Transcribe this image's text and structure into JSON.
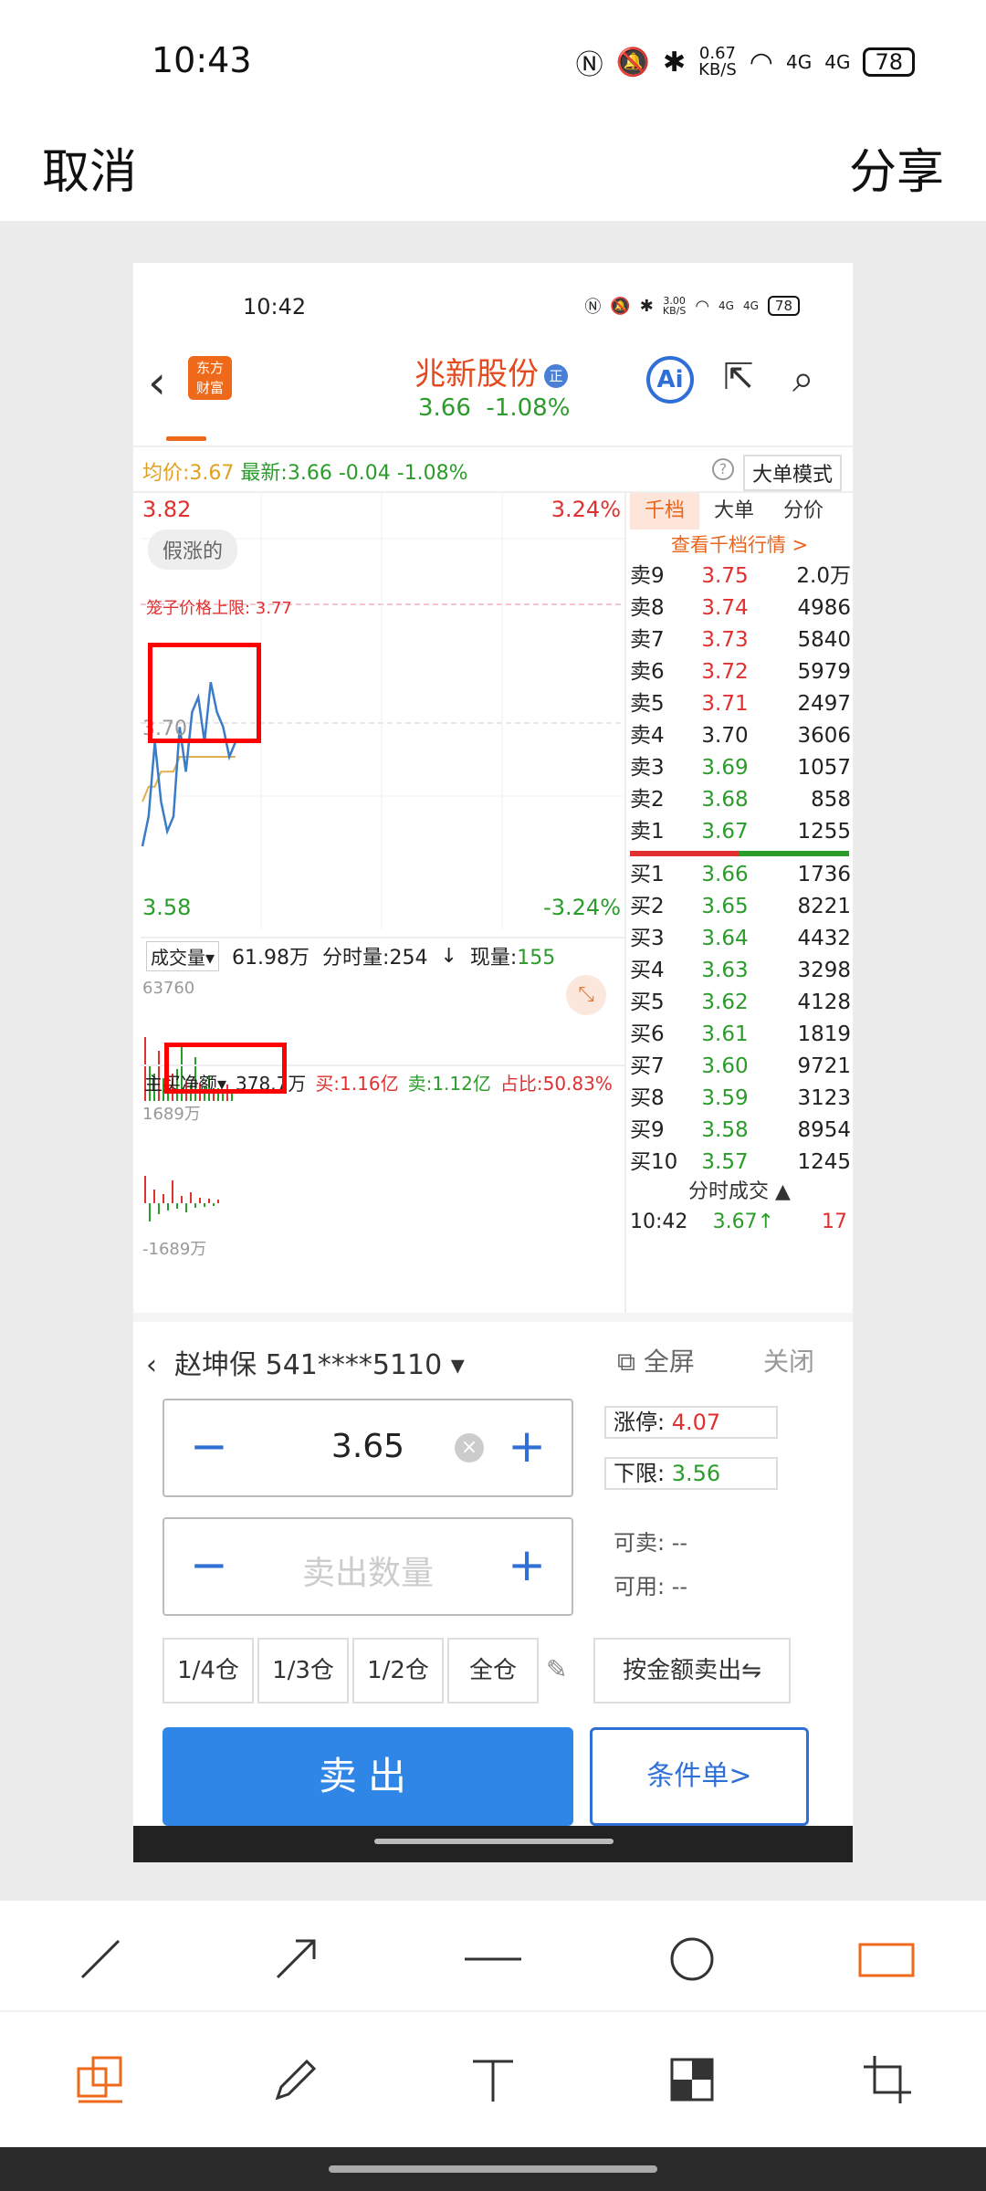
{
  "statusbar": {
    "time": "10:43",
    "net_speed": "0.67\nKB/S",
    "net_speed_top": "0.67",
    "net_speed_bottom": "KB/S",
    "sig1": "4G",
    "sig2": "4G",
    "battery": "78"
  },
  "editor": {
    "cancel": "取消",
    "share": "分享"
  },
  "shot": {
    "status": {
      "time": "10:42",
      "net_top": "3.00",
      "net_bottom": "KB/S",
      "sig1": "4G",
      "sig2": "4G",
      "battery": "78"
    },
    "nav": {
      "logo_line1": "东方",
      "logo_line2": "财富",
      "stock_name": "兆新股份",
      "badge": "正",
      "price": "3.66",
      "change": "-1.08%",
      "ai": "Ai"
    },
    "avg": {
      "avg_label": "均价:",
      "avg_value": "3.67",
      "latest_label": "最新:",
      "latest_value": "3.66",
      "diff": "-0.04",
      "pct": "-1.08%",
      "mode": "大单模式",
      "help": "?"
    },
    "chart": {
      "top_left": "3.82",
      "top_right": "3.24%",
      "bottom_left": "3.58",
      "bottom_right": "-3.24%",
      "tag": "假涨的",
      "cage": "笼子价格上限: 3.77",
      "mid": "3.70",
      "vol_label": "成交量",
      "vol_value": "61.98万",
      "time_vol": "分时量:254",
      "cur_label": "现量:",
      "cur_value": "155",
      "vol_max": "63760",
      "flow_label": "主买净额",
      "flow_value": "378.7万",
      "buy_label": "买:1.16亿",
      "sell_label": "卖:1.12亿",
      "ratio": "占比:50.83%",
      "flow_max": "1689万",
      "flow_min": "-1689万"
    },
    "chart_data": {
      "type": "line",
      "series": [
        {
          "values": [
            3.61,
            3.63,
            3.68,
            3.64,
            3.62,
            3.63,
            3.69,
            3.66,
            3.7,
            3.71,
            3.68,
            3.72,
            3.7,
            3.69,
            3.67,
            3.68
          ]
        },
        {
          "values": [
            3.64,
            3.65,
            3.65,
            3.66,
            3.66,
            3.66,
            3.67,
            3.67,
            3.67,
            3.67,
            3.67,
            3.67,
            3.67,
            3.67,
            3.67,
            3.67
          ]
        }
      ],
      "ylim": [
        3.58,
        3.82
      ]
    },
    "panel": {
      "tabs": [
        "千档",
        "大单",
        "分价"
      ],
      "view": "查看千档行情 >",
      "sells": [
        {
          "l": "卖9",
          "p": "3.75",
          "v": "2.0万",
          "c": "red"
        },
        {
          "l": "卖8",
          "p": "3.74",
          "v": "4986",
          "c": "red"
        },
        {
          "l": "卖7",
          "p": "3.73",
          "v": "5840",
          "c": "red"
        },
        {
          "l": "卖6",
          "p": "3.72",
          "v": "5979",
          "c": "red"
        },
        {
          "l": "卖5",
          "p": "3.71",
          "v": "2497",
          "c": "red"
        },
        {
          "l": "卖4",
          "p": "3.70",
          "v": "3606",
          "c": "blk"
        },
        {
          "l": "卖3",
          "p": "3.69",
          "v": "1057",
          "c": "grn"
        },
        {
          "l": "卖2",
          "p": "3.68",
          "v": "858",
          "c": "grn"
        },
        {
          "l": "卖1",
          "p": "3.67",
          "v": "1255",
          "c": "grn"
        }
      ],
      "buys": [
        {
          "l": "买1",
          "p": "3.66",
          "v": "1736",
          "c": "grn"
        },
        {
          "l": "买2",
          "p": "3.65",
          "v": "8221",
          "c": "grn"
        },
        {
          "l": "买3",
          "p": "3.64",
          "v": "4432",
          "c": "grn"
        },
        {
          "l": "买4",
          "p": "3.63",
          "v": "3298",
          "c": "grn"
        },
        {
          "l": "买5",
          "p": "3.62",
          "v": "4128",
          "c": "grn"
        },
        {
          "l": "买6",
          "p": "3.61",
          "v": "1819",
          "c": "grn"
        },
        {
          "l": "买7",
          "p": "3.60",
          "v": "9721",
          "c": "grn"
        },
        {
          "l": "买8",
          "p": "3.59",
          "v": "3123",
          "c": "grn"
        },
        {
          "l": "买9",
          "p": "3.58",
          "v": "8954",
          "c": "grn"
        },
        {
          "l": "买10",
          "p": "3.57",
          "v": "1245",
          "c": "grn"
        }
      ],
      "ticks_head": "分时成交 ▲",
      "tick_time": "10:42",
      "tick_price": "3.67↑",
      "tick_vol": "17"
    },
    "trade": {
      "account": "赵坤保 541****5110",
      "fullscreen": "全屏",
      "close": "关闭",
      "price": "3.65",
      "qty_placeholder": "卖出数量",
      "limit_up_label": "涨停:",
      "limit_up": "4.07",
      "limit_down_label": "下限:",
      "limit_down": "3.56",
      "sellable_label": "可卖:",
      "sellable": "--",
      "available_label": "可用:",
      "available": "--",
      "pos1": "1/4仓",
      "pos2": "1/3仓",
      "pos3": "1/2仓",
      "pos4": "全仓",
      "by_amount": "按金额卖出⇋",
      "sell": "卖出",
      "conditional": "条件单>"
    }
  },
  "tools": {
    "row1": [
      "line-tool",
      "arrow-tool",
      "dash-tool",
      "circle-tool",
      "rect-tool"
    ],
    "row2": [
      "layers-tool",
      "pen-tool",
      "text-tool",
      "mosaic-tool",
      "crop-tool"
    ]
  }
}
